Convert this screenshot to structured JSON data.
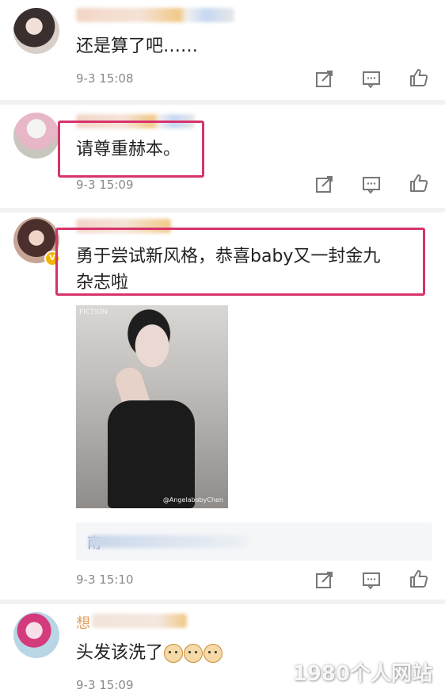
{
  "comments": [
    {
      "text": "还是算了吧……",
      "time": "9-3 15:08"
    },
    {
      "text": "请尊重赫本。",
      "time": "9-3 15:09"
    },
    {
      "text_line1": "勇于尝试新风格，恭喜baby又一封金九",
      "text_line2": "杂志啦",
      "time": "9-3 15:10",
      "photo_mark": "FICTION",
      "photo_caption": "@AngelababyChen",
      "reply_prefix": "南"
    },
    {
      "name_first": "想",
      "text": "头发该洗了",
      "time": "9-3 15:09"
    }
  ],
  "actions": {
    "repost_icon": "repost-icon",
    "reply_icon": "comment-icon",
    "like_icon": "like-icon"
  },
  "watermark": "1980个人网站",
  "colors": {
    "highlight": "#d6336c",
    "timestamp": "#8a8a8a",
    "link": "#5b7fb2"
  }
}
